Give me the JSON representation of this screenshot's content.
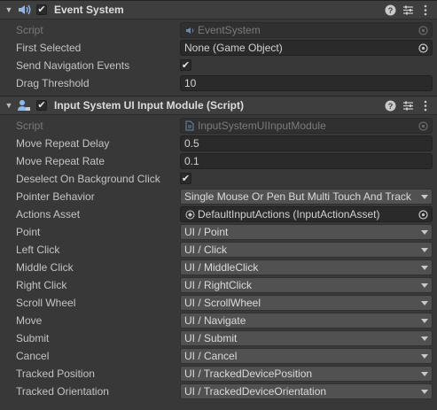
{
  "event_system": {
    "title": "Event System",
    "script_label": "Script",
    "script_value": "EventSystem",
    "first_selected_label": "First Selected",
    "first_selected_value": "None (Game Object)",
    "send_nav_label": "Send Navigation Events",
    "send_nav_checked": true,
    "drag_threshold_label": "Drag Threshold",
    "drag_threshold_value": "10"
  },
  "input_module": {
    "title": "Input System UI Input Module (Script)",
    "script_label": "Script",
    "script_value": "InputSystemUIInputModule",
    "move_repeat_delay_label": "Move Repeat Delay",
    "move_repeat_delay_value": "0.5",
    "move_repeat_rate_label": "Move Repeat Rate",
    "move_repeat_rate_value": "0.1",
    "deselect_label": "Deselect On Background Click",
    "deselect_checked": true,
    "pointer_behavior_label": "Pointer Behavior",
    "pointer_behavior_value": "Single Mouse Or Pen But Multi Touch And Track",
    "actions_asset_label": "Actions Asset",
    "actions_asset_value": "DefaultInputActions (InputActionAsset)",
    "actions": [
      {
        "label": "Point",
        "value": "UI / Point"
      },
      {
        "label": "Left Click",
        "value": "UI / Click"
      },
      {
        "label": "Middle Click",
        "value": "UI / MiddleClick"
      },
      {
        "label": "Right Click",
        "value": "UI / RightClick"
      },
      {
        "label": "Scroll Wheel",
        "value": "UI / ScrollWheel"
      },
      {
        "label": "Move",
        "value": "UI / Navigate"
      },
      {
        "label": "Submit",
        "value": "UI / Submit"
      },
      {
        "label": "Cancel",
        "value": "UI / Cancel"
      },
      {
        "label": "Tracked Position",
        "value": "UI / TrackedDevicePosition"
      },
      {
        "label": "Tracked Orientation",
        "value": "UI / TrackedDeviceOrientation"
      }
    ]
  },
  "icons": {
    "foldout": "chevron-down-icon",
    "event_system": "event-system-icon",
    "input_module": "input-module-icon",
    "help": "help-icon",
    "presets": "presets-icon",
    "menu": "kebab-menu-icon",
    "object_picker": "object-picker-icon"
  },
  "colors": {
    "background": "#383838",
    "header": "#3e3e3e",
    "field": "#2a2a2a",
    "dropdown": "#515151",
    "text": "#c4c4c4"
  }
}
